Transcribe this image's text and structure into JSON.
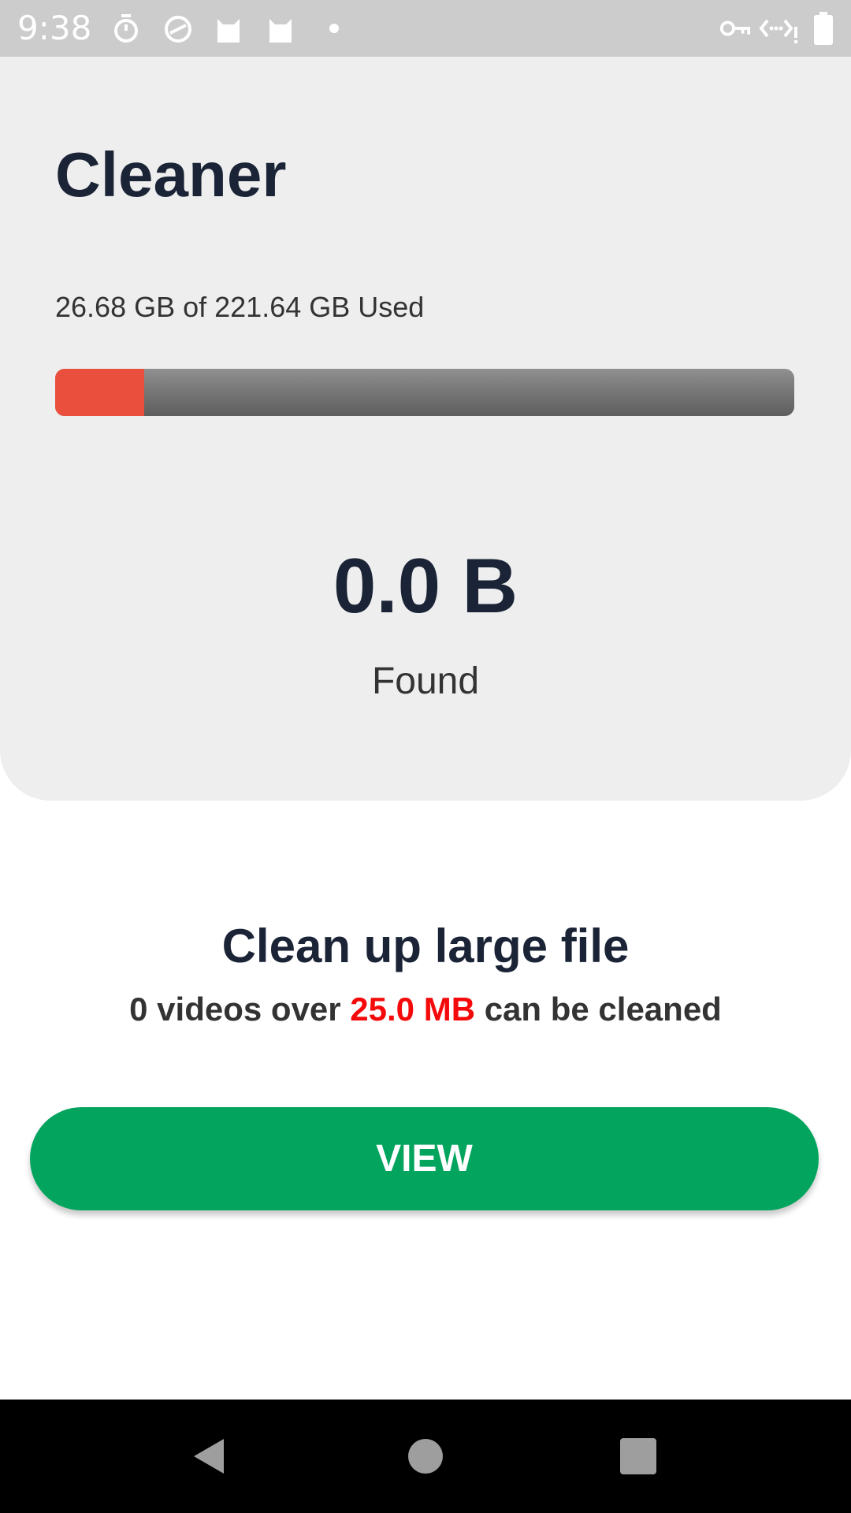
{
  "status_bar": {
    "time": "9:38",
    "left_icons": [
      "timer-icon",
      "speedometer-icon",
      "cat-icon",
      "cat-icon",
      "dot-icon"
    ],
    "right_icons": [
      "vpn-key-icon",
      "data-saver-icon",
      "battery-icon"
    ]
  },
  "header": {
    "title": "Cleaner",
    "storage_text": "26.68 GB of 221.64 GB Used",
    "storage_used_fraction": 0.12,
    "storage_fill_color": "#ea4f3e",
    "found_size": "0.0 B",
    "found_label": "Found"
  },
  "large_files": {
    "title": "Clean up large file",
    "desc_prefix": "0 videos over ",
    "desc_highlight": "25.0 MB",
    "desc_suffix": " can be cleaned",
    "highlight_color": "#f40a0a",
    "button_label": "VIEW",
    "button_color": "#03a45e"
  },
  "nav_bar": {
    "buttons": [
      "back-icon",
      "home-icon",
      "recents-icon"
    ]
  }
}
